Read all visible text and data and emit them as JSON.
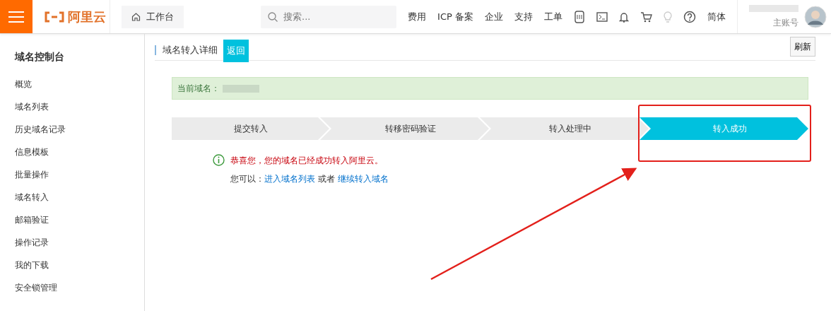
{
  "topbar": {
    "logo_text": "阿里云",
    "workbench": "工作台",
    "search": {
      "placeholder": "搜索..."
    },
    "nav": [
      "费用",
      "ICP 备案",
      "企业",
      "支持",
      "工单"
    ],
    "language": "简体",
    "account_role": "主账号"
  },
  "sidebar": {
    "title": "域名控制台",
    "items": [
      {
        "label": "概览",
        "selected": false
      },
      {
        "label": "域名列表",
        "selected": false
      },
      {
        "label": "历史域名记录",
        "selected": false
      },
      {
        "label": "信息模板",
        "selected": false
      },
      {
        "label": "批量操作",
        "selected": false
      },
      {
        "label": "域名转入",
        "selected": false
      },
      {
        "label": "邮箱验证",
        "selected": false
      },
      {
        "label": "操作记录",
        "selected": false
      },
      {
        "label": "我的下载",
        "selected": false
      },
      {
        "label": "安全锁管理",
        "selected": false
      }
    ]
  },
  "page": {
    "title": "域名转入详细",
    "back_button": "返回",
    "refresh_button": "刷新",
    "current_domain_label": "当前域名：",
    "steps": [
      {
        "label": "提交转入",
        "selected": false
      },
      {
        "label": "转移密码验证",
        "selected": false
      },
      {
        "label": "转入处理中",
        "selected": false
      },
      {
        "label": "转入成功",
        "selected": true
      }
    ],
    "success_message": "恭喜您，您的域名已经成功转入阿里云。",
    "next_prefix": "您可以：",
    "next_link_1": "进入域名列表",
    "next_middle": "或者",
    "next_link_2": "继续转入域名"
  }
}
